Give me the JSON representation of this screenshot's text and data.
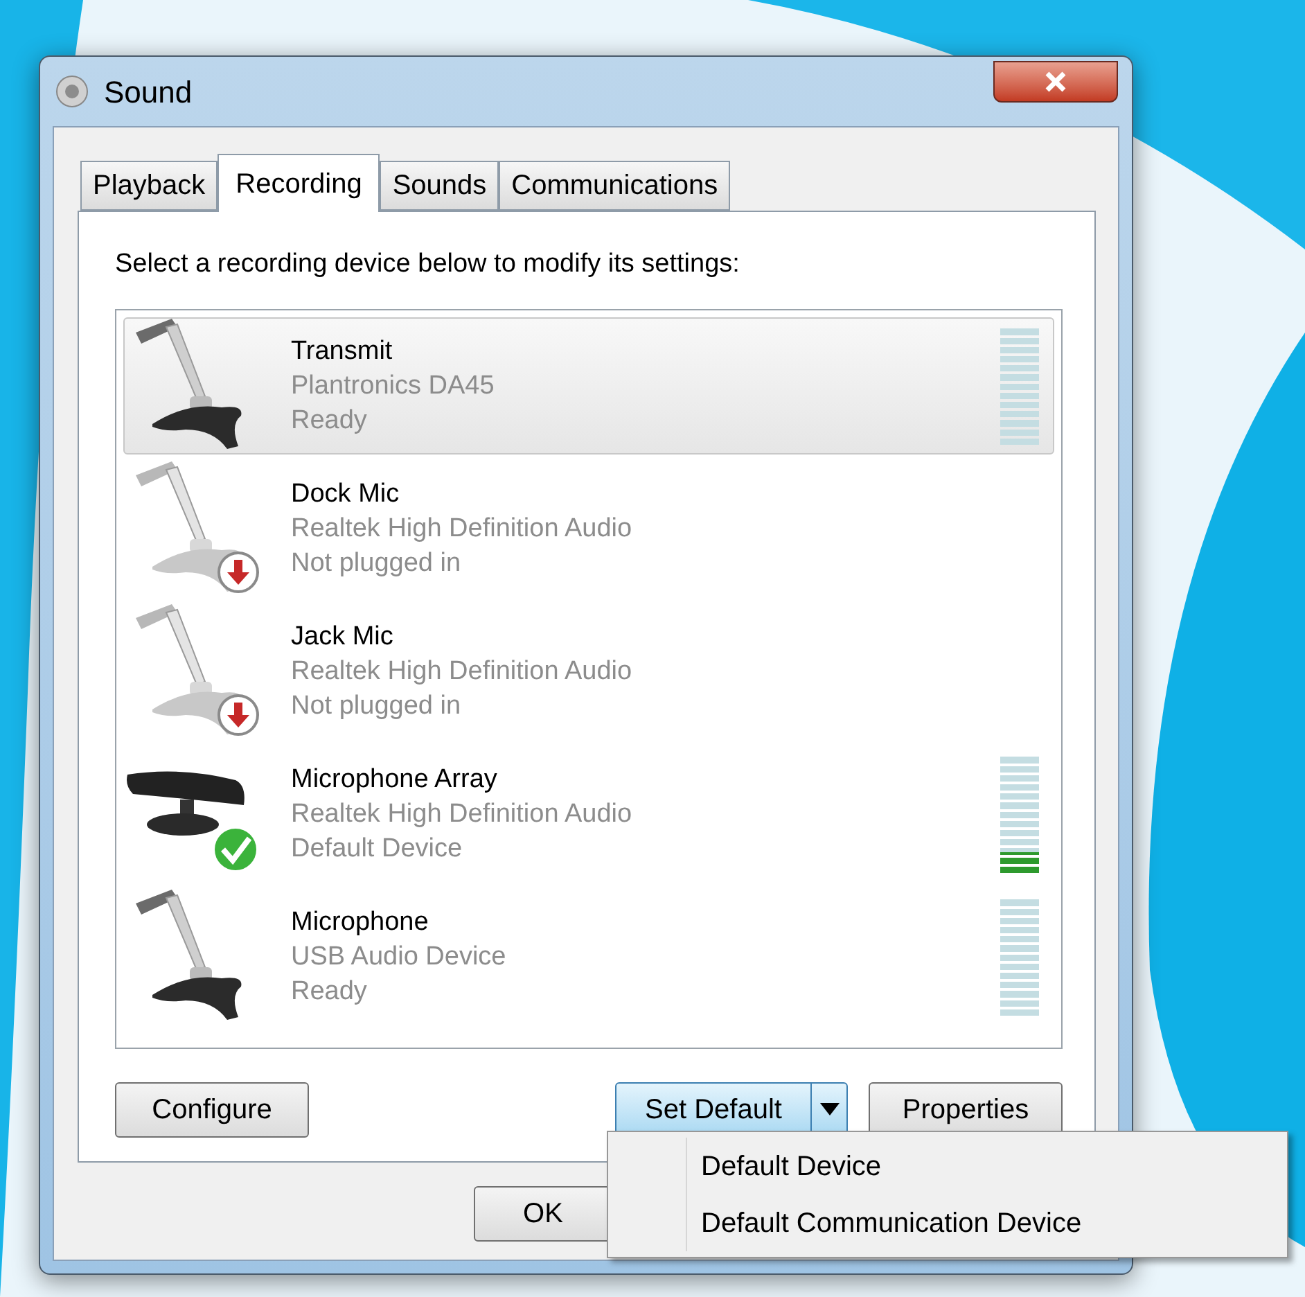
{
  "window": {
    "title": "Sound"
  },
  "tabs": [
    {
      "label": "Playback",
      "selected": false
    },
    {
      "label": "Recording",
      "selected": true
    },
    {
      "label": "Sounds",
      "selected": false
    },
    {
      "label": "Communications",
      "selected": false
    }
  ],
  "instruction": "Select a recording device below to modify its settings:",
  "devices": [
    {
      "name": "Transmit",
      "driver": "Plantronics DA45",
      "status": "Ready",
      "kind": "mic",
      "selected": true,
      "level": 0
    },
    {
      "name": "Dock Mic",
      "driver": "Realtek High Definition Audio",
      "status": "Not plugged in",
      "kind": "mic-unplugged",
      "selected": false
    },
    {
      "name": "Jack Mic",
      "driver": "Realtek High Definition Audio",
      "status": "Not plugged in",
      "kind": "mic-unplugged",
      "selected": false
    },
    {
      "name": "Microphone Array",
      "driver": "Realtek High Definition Audio",
      "status": "Default Device",
      "kind": "array-default",
      "selected": false,
      "level": 0.17
    },
    {
      "name": "Microphone",
      "driver": "USB Audio Device",
      "status": "Ready",
      "kind": "mic",
      "selected": false,
      "level": 0
    }
  ],
  "buttons": {
    "configure": "Configure",
    "set_default": "Set Default",
    "properties": "Properties",
    "ok": "OK"
  },
  "set_default_menu": [
    {
      "label": "Default Device"
    },
    {
      "label": "Default Communication Device"
    }
  ]
}
